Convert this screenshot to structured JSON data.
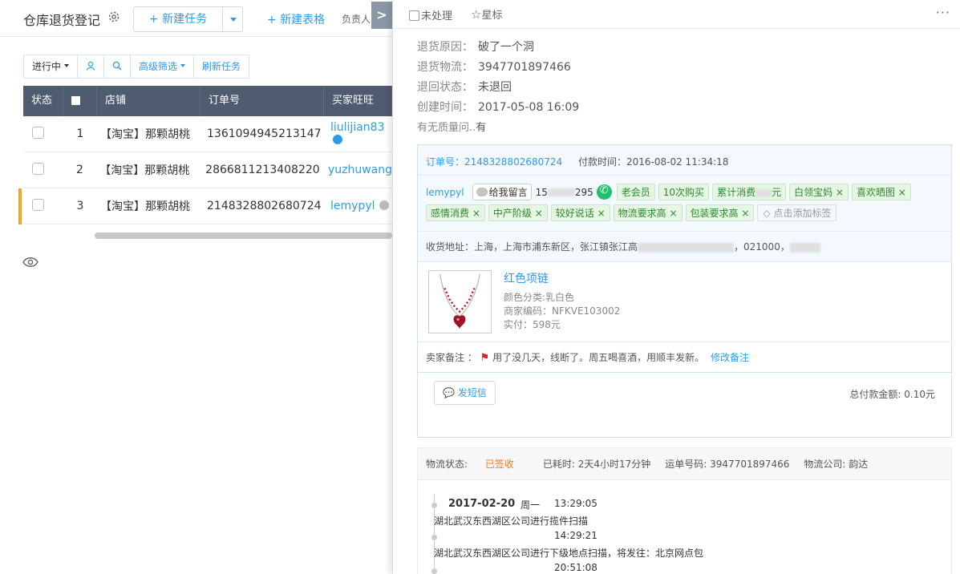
{
  "page": {
    "title": "仓库退货登记",
    "new_task_label": "新建任务",
    "new_form_label": "新建表格",
    "owner_label": "负责人",
    "collapse_label": ">"
  },
  "filters": {
    "status": "进行中",
    "advanced": "高级筛选",
    "refresh": "刷新任务"
  },
  "table": {
    "headers": [
      "状态",
      "",
      "店铺",
      "订单号",
      "买家旺旺"
    ],
    "rows": [
      {
        "index": "1",
        "shop": "【淘宝】那颗胡桃",
        "order": "1361094945213147",
        "buyer": "liulijian83"
      },
      {
        "index": "2",
        "shop": "【淘宝】那颗胡桃",
        "order": "2866811213408220",
        "buyer": "yuzhuwang"
      },
      {
        "index": "3",
        "shop": "【淘宝】那颗胡桃",
        "order": "2148328802680724",
        "buyer": "lemypyl"
      }
    ]
  },
  "panel": {
    "unprocessed_label": "未处理",
    "star_label": "星标",
    "more_label": "···",
    "fields": [
      {
        "label": "退货原因：",
        "value": "破了一个洞"
      },
      {
        "label": "退货物流：",
        "value": "3947701897466"
      },
      {
        "label": "退回状态：",
        "value": "未退回"
      },
      {
        "label": "创建时间：",
        "value": "2017-05-08 16:09"
      },
      {
        "label": "有无质量问..",
        "value": "有"
      }
    ]
  },
  "order": {
    "order_no_label": "订单号：2148328802680724",
    "pay_time_label": "付款时间：2016-08-02 11:34:18",
    "buyer_name": "lemypyl",
    "message_label": "给我留言",
    "phone_start": "15",
    "phone_end": "295",
    "tags_row1": [
      "老会员",
      "10次购买",
      "累计消费",
      "白领宝妈 ×",
      "喜欢晒图 ×"
    ],
    "spend_unit": "元",
    "tags_row2": [
      "感情消费 ×",
      "中产阶级 ×",
      "较好说话 ×",
      "物流要求高 ×",
      "包装要求高 ×"
    ],
    "add_tag_label": "点击添加标签",
    "address_start": "收货地址：上海，上海市浦东新区，张江镇张江高",
    "address_zip": "，021000，",
    "product_name": "红色项链",
    "product_color": "颜色分类:乳白色",
    "product_code": "商家编码：NFKVE103002",
    "product_paid": "实付：598元",
    "seller_note_label": "卖家备注 ：",
    "seller_note_text": "用了没几天，线断了。周五喝喜酒，用顺丰发新。",
    "edit_note_label": "修改备注",
    "sms_label": "发短信",
    "total_label": "总付款金额: 0.10元"
  },
  "logistics": {
    "status_label": "物流状态:",
    "status_value": "已签收",
    "elapsed": "已耗时: 2天4小时17分钟",
    "waybill": "运单号码: 3947701897466",
    "company": "物流公司: 韵达",
    "date": "2017-02-20",
    "weekday": "周一",
    "events": [
      {
        "time": "13:29:05",
        "text": "湖北武汉东西湖区公司进行揽件扫描"
      },
      {
        "time": "14:29:21",
        "text": "湖北武汉东西湖区公司进行下级地点扫描，将发往：北京网点包"
      },
      {
        "time": "20:51:08",
        "text": ""
      }
    ]
  },
  "colors": {
    "accent": "#2d9be6",
    "header": "#4f5b6e",
    "tag_green": "#2b8a2b",
    "signed": "#f5781e",
    "row_mark": "#f5a623"
  }
}
